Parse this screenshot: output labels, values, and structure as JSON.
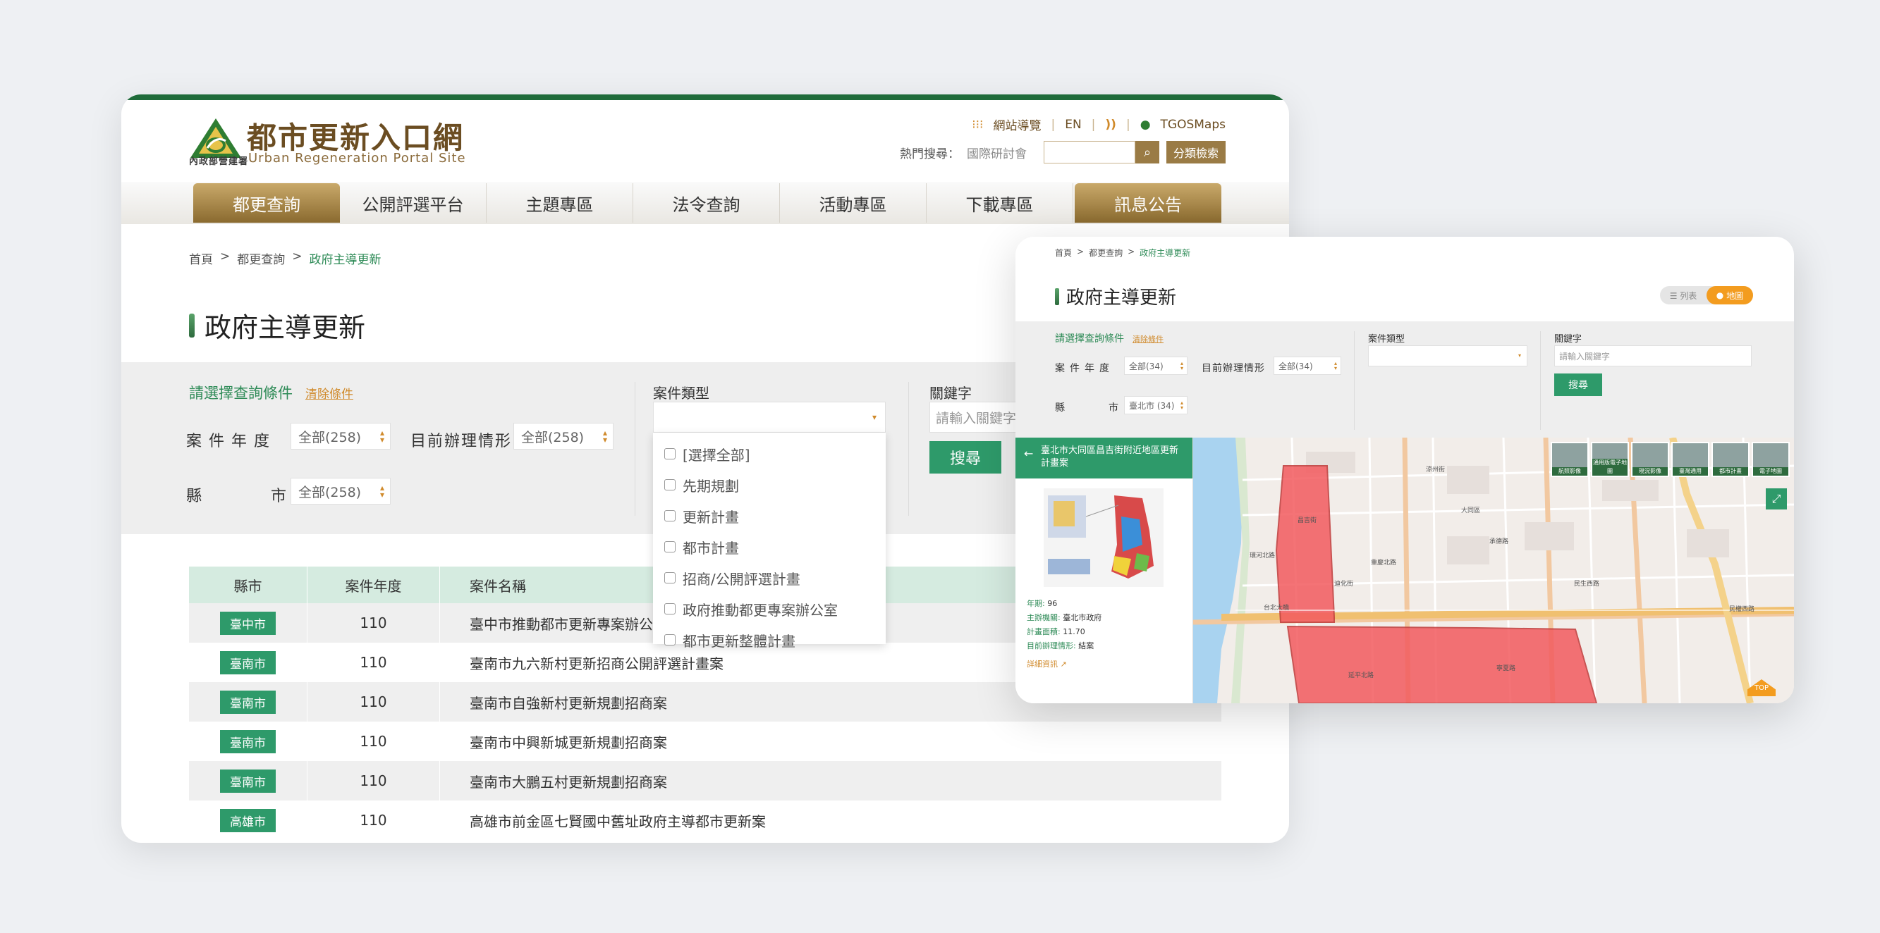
{
  "main": {
    "logo": {
      "title": "都市更新入口網",
      "subtitle": "Urban Regeneration Portal Site",
      "org": "內政部營建署"
    },
    "util": {
      "sitemap": "網站導覽",
      "en": "EN",
      "tgos": "TGOSMaps"
    },
    "hot_search": {
      "label": "熱門搜尋：",
      "word": "國際研討會",
      "input_value": "",
      "category_button": "分類檢索"
    },
    "nav": [
      "都更查詢",
      "公開評選平台",
      "主題專區",
      "法令查詢",
      "活動專區",
      "下載專區",
      "訊息公告"
    ],
    "breadcrumb": {
      "home": "首頁",
      "level1": "都更查詢",
      "current": "政府主導更新"
    },
    "page_title": "政府主導更新",
    "filter": {
      "heading": "請選擇查詢條件",
      "clear": "清除條件",
      "year_label": "案件年度",
      "year_value": "全部(258)",
      "status_label": "目前辦理情形",
      "status_value": "全部(258)",
      "county_label": "縣市",
      "county_value": "全部(258)",
      "type_label": "案件類型",
      "keyword_label": "關鍵字",
      "keyword_placeholder": "請輸入關鍵字",
      "search_button": "搜尋"
    },
    "type_options": [
      "[選擇全部]",
      "先期規劃",
      "更新計畫",
      "都市計畫",
      "招商/公開評選計畫",
      "政府推動都更專案辦公室",
      "都市更新整體計畫"
    ],
    "table": {
      "headers": [
        "縣市",
        "案件年度",
        "案件名稱"
      ],
      "rows": [
        {
          "county": "臺中市",
          "year": "110",
          "name": "臺中市推動都市更新專案辦公"
        },
        {
          "county": "臺南市",
          "year": "110",
          "name": "臺南市九六新村更新招商公開評選計畫案"
        },
        {
          "county": "臺南市",
          "year": "110",
          "name": "臺南市自強新村更新規劃招商案"
        },
        {
          "county": "臺南市",
          "year": "110",
          "name": "臺南市中興新城更新規劃招商案"
        },
        {
          "county": "臺南市",
          "year": "110",
          "name": "臺南市大鵬五村更新規劃招商案"
        },
        {
          "county": "高雄市",
          "year": "110",
          "name": "高雄市前金區七賢國中舊址政府主導都市更新案"
        }
      ]
    }
  },
  "overlay": {
    "breadcrumb": {
      "home": "首頁",
      "level1": "都更查詢",
      "current": "政府主導更新"
    },
    "page_title": "政府主導更新",
    "view_toggle": {
      "list": "列表",
      "map": "地圖"
    },
    "filter": {
      "heading": "請選擇查詢條件",
      "clear": "清除條件",
      "year_label": "案件年度",
      "year_value": "全部(34)",
      "status_label": "目前辦理情形",
      "status_value": "全部(34)",
      "county_label": "縣市",
      "county_value": "臺北市 (34)",
      "type_label": "案件類型",
      "keyword_label": "關鍵字",
      "keyword_placeholder": "請輸入關鍵字",
      "search_button": "搜尋"
    },
    "case": {
      "title": "臺北市大同區昌吉街附近地區更新計畫案",
      "year_key": "年期:",
      "year": "96",
      "agency_key": "主辦機關:",
      "agency": "臺北市政府",
      "area_key": "計畫面積:",
      "area": "11.70",
      "status_key": "目前辦理情形:",
      "status": "結案",
      "more": "詳細資訊"
    },
    "map": {
      "labels": [
        "台北大橋",
        "民權西路",
        "昌吉街",
        "重慶北路",
        "承德路",
        "大同區",
        "民生西路",
        "延平北路",
        "環河北路",
        "涼州街",
        "迪化街",
        "寧夏路"
      ],
      "tools": [
        "航照影像",
        "通用版電子地圖",
        "現況影像",
        "臺灣通用",
        "都市計畫",
        "電子地圖"
      ],
      "top": "TOP"
    }
  }
}
